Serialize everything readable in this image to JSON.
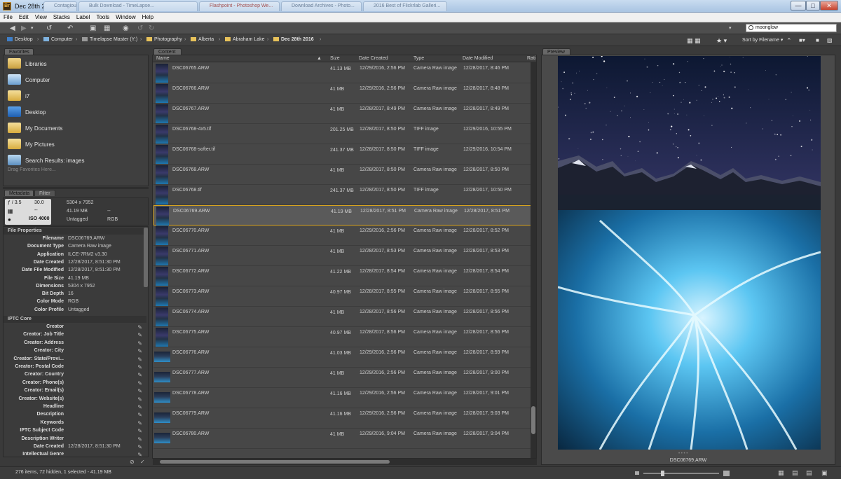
{
  "window": {
    "title": "Dec 28th 2016",
    "app_icon_label": "Br",
    "background_tabs": [
      "Contagious...",
      "Bulk Download - TimeLapse...",
      "Flashpoint - Photoshop We...",
      "Download Archives - Photo...",
      "2016 Best of Flickrlab Galleri..."
    ]
  },
  "menu": [
    "File",
    "Edit",
    "View",
    "Stacks",
    "Label",
    "Tools",
    "Window",
    "Help"
  ],
  "search": {
    "value": "moonglow"
  },
  "sort": {
    "label": "Sort by Filename"
  },
  "breadcrumbs": [
    "Desktop",
    "Computer",
    "Timelapse Master (Y:)",
    "Photography",
    "Alberta",
    "Abraham Lake",
    "Dec 28th 2016"
  ],
  "favorites": {
    "tab_label": "Favorites",
    "items": [
      "Libraries",
      "Computer",
      "i7",
      "Desktop",
      "My Documents",
      "My Pictures",
      "Search Results: images"
    ],
    "drag_hint": "Drag Favorites Here..."
  },
  "metadata": {
    "tab_label": "Metadata",
    "filter_tab_label": "Filter",
    "summary": {
      "aperture": "ƒ / 3.5",
      "shutter": "30.0",
      "exposure": "--",
      "iso": "ISO 4000",
      "dimensions": "5304 x 7952",
      "size": "41.19 MB",
      "dash": "--",
      "label": "Untagged",
      "mode": "RGB"
    },
    "file_properties_header": "File Properties",
    "file_properties": [
      {
        "key": "Filename",
        "value": "DSC06769.ARW"
      },
      {
        "key": "Document Type",
        "value": "Camera Raw image"
      },
      {
        "key": "Application",
        "value": "ILCE-7RM2 v3.30"
      },
      {
        "key": "Date Created",
        "value": "12/28/2017, 8:51:30 PM"
      },
      {
        "key": "Date File Modified",
        "value": "12/28/2017, 8:51:30 PM"
      },
      {
        "key": "File Size",
        "value": "41.19 MB"
      },
      {
        "key": "Dimensions",
        "value": "5304 x 7952"
      },
      {
        "key": "Bit Depth",
        "value": "16"
      },
      {
        "key": "Color Mode",
        "value": "RGB"
      },
      {
        "key": "Color Profile",
        "value": "Untagged"
      }
    ],
    "iptc_header": "IPTC Core",
    "iptc": [
      {
        "key": "Creator",
        "value": ""
      },
      {
        "key": "Creator: Job Title",
        "value": ""
      },
      {
        "key": "Creator: Address",
        "value": ""
      },
      {
        "key": "Creator: City",
        "value": ""
      },
      {
        "key": "Creator: State/Provi...",
        "value": ""
      },
      {
        "key": "Creator: Postal Code",
        "value": ""
      },
      {
        "key": "Creator: Country",
        "value": ""
      },
      {
        "key": "Creator: Phone(s)",
        "value": ""
      },
      {
        "key": "Creator: Email(s)",
        "value": ""
      },
      {
        "key": "Creator: Website(s)",
        "value": ""
      },
      {
        "key": "Headline",
        "value": ""
      },
      {
        "key": "Description",
        "value": ""
      },
      {
        "key": "Keywords",
        "value": ""
      },
      {
        "key": "IPTC Subject Code",
        "value": ""
      },
      {
        "key": "Description Writer",
        "value": ""
      },
      {
        "key": "Date Created",
        "value": "12/28/2017, 8:51:30 PM"
      },
      {
        "key": "Intellectual Genre",
        "value": ""
      }
    ]
  },
  "content": {
    "tab_label": "Content",
    "columns": {
      "name": "Name",
      "size": "Size",
      "created": "Date Created",
      "type": "Type",
      "modified": "Date Modified",
      "rating": "Rati"
    },
    "rows": [
      {
        "name": "DSC06765.ARW",
        "size": "41.13 MB",
        "created": "12/29/2016, 2:56 PM",
        "type": "Camera Raw image",
        "modified": "12/28/2017, 8:46 PM",
        "thumb": "portrait"
      },
      {
        "name": "DSC06766.ARW",
        "size": "41 MB",
        "created": "12/29/2016, 2:56 PM",
        "type": "Camera Raw image",
        "modified": "12/28/2017, 8:48 PM",
        "thumb": "portrait"
      },
      {
        "name": "DSC06767.ARW",
        "size": "41 MB",
        "created": "12/28/2017, 8:49 PM",
        "type": "Camera Raw image",
        "modified": "12/28/2017, 8:49 PM",
        "thumb": "portrait"
      },
      {
        "name": "DSC06768-4x5.tif",
        "size": "201.25 MB",
        "created": "12/28/2017, 8:50 PM",
        "type": "TIFF image",
        "modified": "12/29/2016, 10:55 PM",
        "thumb": "portrait"
      },
      {
        "name": "DSC06768-softer.tif",
        "size": "241.37 MB",
        "created": "12/28/2017, 8:50 PM",
        "type": "TIFF image",
        "modified": "12/29/2016, 10:54 PM",
        "thumb": "portrait"
      },
      {
        "name": "DSC06768.ARW",
        "size": "41 MB",
        "created": "12/28/2017, 8:50 PM",
        "type": "Camera Raw image",
        "modified": "12/28/2017, 8:50 PM",
        "thumb": "portrait"
      },
      {
        "name": "DSC06768.tif",
        "size": "241.37 MB",
        "created": "12/28/2017, 8:50 PM",
        "type": "TIFF image",
        "modified": "12/28/2017, 10:50 PM",
        "thumb": "portrait"
      },
      {
        "name": "DSC06769.ARW",
        "size": "41.19 MB",
        "created": "12/28/2017, 8:51 PM",
        "type": "Camera Raw image",
        "modified": "12/28/2017, 8:51 PM",
        "thumb": "portrait",
        "selected": true
      },
      {
        "name": "DSC06770.ARW",
        "size": "41 MB",
        "created": "12/29/2016, 2:56 PM",
        "type": "Camera Raw image",
        "modified": "12/28/2017, 8:52 PM",
        "thumb": "portrait"
      },
      {
        "name": "DSC06771.ARW",
        "size": "41 MB",
        "created": "12/28/2017, 8:53 PM",
        "type": "Camera Raw image",
        "modified": "12/28/2017, 8:53 PM",
        "thumb": "portrait"
      },
      {
        "name": "DSC06772.ARW",
        "size": "41.22 MB",
        "created": "12/28/2017, 8:54 PM",
        "type": "Camera Raw image",
        "modified": "12/28/2017, 8:54 PM",
        "thumb": "portrait"
      },
      {
        "name": "DSC06773.ARW",
        "size": "40.97 MB",
        "created": "12/28/2017, 8:55 PM",
        "type": "Camera Raw image",
        "modified": "12/28/2017, 8:55 PM",
        "thumb": "portrait"
      },
      {
        "name": "DSC06774.ARW",
        "size": "41 MB",
        "created": "12/28/2017, 8:56 PM",
        "type": "Camera Raw image",
        "modified": "12/28/2017, 8:56 PM",
        "thumb": "portrait"
      },
      {
        "name": "DSC06775.ARW",
        "size": "40.97 MB",
        "created": "12/28/2017, 8:56 PM",
        "type": "Camera Raw image",
        "modified": "12/28/2017, 8:56 PM",
        "thumb": "portrait"
      },
      {
        "name": "DSC06776.ARW",
        "size": "41.03 MB",
        "created": "12/29/2016, 2:56 PM",
        "type": "Camera Raw image",
        "modified": "12/28/2017, 8:59 PM",
        "thumb": "landscape"
      },
      {
        "name": "DSC06777.ARW",
        "size": "41 MB",
        "created": "12/29/2016, 2:56 PM",
        "type": "Camera Raw image",
        "modified": "12/28/2017, 9:00 PM",
        "thumb": "landscape"
      },
      {
        "name": "DSC06778.ARW",
        "size": "41.16 MB",
        "created": "12/29/2016, 2:56 PM",
        "type": "Camera Raw image",
        "modified": "12/28/2017, 9:01 PM",
        "thumb": "landscape"
      },
      {
        "name": "DSC06779.ARW",
        "size": "41.16 MB",
        "created": "12/29/2016, 2:56 PM",
        "type": "Camera Raw image",
        "modified": "12/28/2017, 9:03 PM",
        "thumb": "landscape"
      },
      {
        "name": "DSC06780.ARW",
        "size": "41 MB",
        "created": "12/29/2016, 9:04 PM",
        "type": "Camera Raw image",
        "modified": "12/28/2017, 9:04 PM",
        "thumb": "landscape"
      }
    ]
  },
  "preview": {
    "tab_label": "Preview",
    "caption": "DSC06769.ARW"
  },
  "status": {
    "text": "276 items, 72 hidden, 1 selected - 41.19 MB"
  },
  "colors": {
    "selection": "#d8a420",
    "panel": "#474747",
    "ice": "#3fb0e8",
    "sky": "#3b3b6e"
  }
}
